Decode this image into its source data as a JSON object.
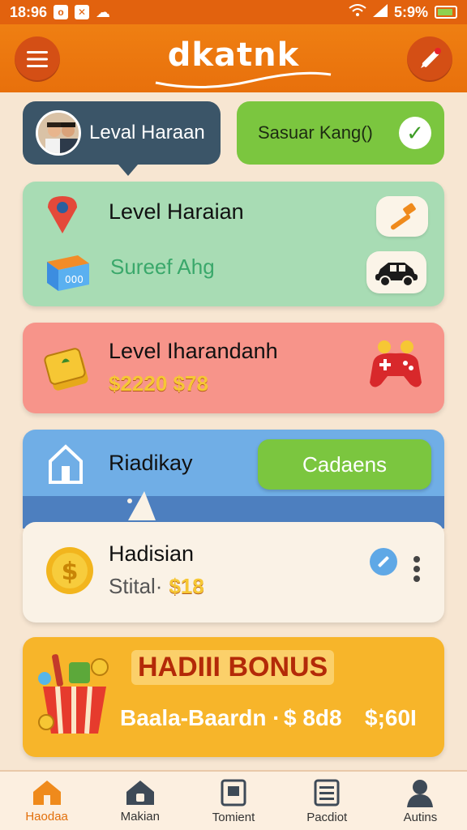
{
  "status_bar": {
    "time": "18:96",
    "right_status": "5:9%"
  },
  "header": {
    "brand": "dkatnk"
  },
  "top_pills": {
    "user_label": "Leval Haraan",
    "green_label": "Sasuar Kang()"
  },
  "cards": {
    "green": {
      "title": "Level Haraian",
      "subtitle": "Sureef Ahg"
    },
    "red": {
      "title": "Level Iharandanh",
      "amount": "$2220 $78"
    },
    "blue": {
      "title": "Riadikay",
      "button": "Cadaens"
    },
    "white": {
      "title": "Hadisian",
      "subtitle": "Stital·",
      "amount": "$18"
    },
    "yellow": {
      "title": "HADIII BONUS",
      "line_left": "Baala-Baardn ·",
      "line_mid": "$ 8d8",
      "line_right": "$;60I"
    }
  },
  "bottom_nav": [
    {
      "label": "Haodaa",
      "icon": "home-icon"
    },
    {
      "label": "Makian",
      "icon": "house-lock-icon"
    },
    {
      "label": "Tomient",
      "icon": "document-icon"
    },
    {
      "label": "Pacdiot",
      "icon": "list-icon"
    },
    {
      "label": "Autins",
      "icon": "person-icon"
    }
  ],
  "colors": {
    "primary": "#e8700c",
    "green": "#7bc63f",
    "card_green": "#a8dcb4",
    "card_red": "#f7948a",
    "card_blue": "#70aee6",
    "card_yellow": "#f7b52a"
  }
}
